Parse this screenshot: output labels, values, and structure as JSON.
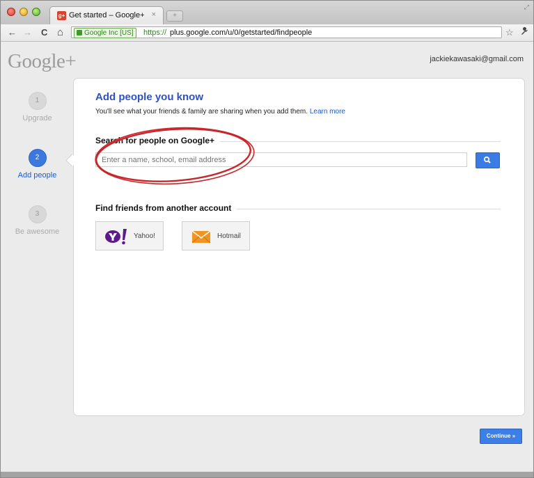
{
  "browser": {
    "tab_title": "Get started – Google+",
    "tab_favicon_text": "g+",
    "tab_close": "×",
    "new_tab": "+",
    "back": "←",
    "forward": "→",
    "reload": "C",
    "home": "⌂",
    "ev_cert": "Google Inc [US]",
    "url_scheme": "https://",
    "url_rest": "plus.google.com/u/0/getstarted/findpeople",
    "bookmark_star": "☆",
    "wrench": "🔧"
  },
  "header": {
    "logo": "Google+",
    "user_email": "jackiekawasaki@gmail.com"
  },
  "steps": [
    {
      "number": "1",
      "label": "Upgrade",
      "active": false
    },
    {
      "number": "2",
      "label": "Add people",
      "active": true
    },
    {
      "number": "3",
      "label": "Be awesome",
      "active": false
    }
  ],
  "card": {
    "title": "Add people you know",
    "subtitle": "You'll see what your friends & family are sharing when you add them.",
    "learn_more": "Learn more",
    "search_heading": "Search for people on Google+",
    "search_placeholder": "Enter a name, school, email address",
    "find_heading": "Find friends from another account",
    "providers": [
      {
        "name": "Yahoo!",
        "icon": "yahoo-logo-icon"
      },
      {
        "name": "Hotmail",
        "icon": "hotmail-envelope-icon"
      }
    ]
  },
  "footer": {
    "continue": "Continue »"
  },
  "colors": {
    "accent_blue": "#3b7ce4",
    "title_blue": "#2b51c4",
    "annotation_red": "#c9262b",
    "yahoo_purple": "#5c1a8b",
    "hotmail_orange": "#f29422"
  }
}
